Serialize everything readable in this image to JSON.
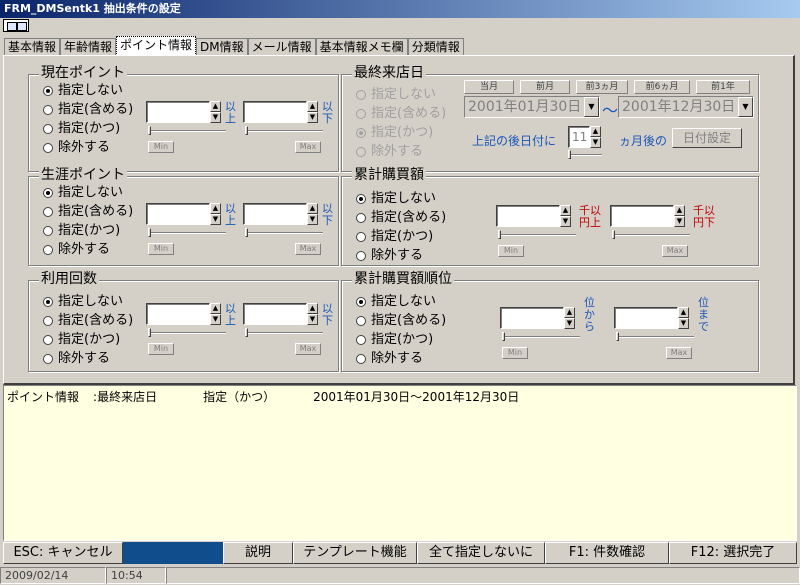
{
  "window": {
    "title": "FRM_DMSentk1 抽出条件の設定"
  },
  "tabs": [
    {
      "label": "基本情報"
    },
    {
      "label": "年齢情報"
    },
    {
      "label": "ポイント情報"
    },
    {
      "label": "DM情報"
    },
    {
      "label": "メール情報"
    },
    {
      "label": "基本情報メモ欄"
    },
    {
      "label": "分類情報"
    }
  ],
  "radio_options": [
    "指定しない",
    "指定(含める)",
    "指定(かつ)",
    "除外する"
  ],
  "groups": {
    "current_point": {
      "title": "現在ポイント",
      "selected": 0,
      "unit_low": "以上",
      "unit_high": "以下"
    },
    "lifetime_point": {
      "title": "生涯ポイント",
      "selected": 0,
      "unit_low": "以上",
      "unit_high": "以下"
    },
    "usage_count": {
      "title": "利用回数",
      "selected": 0,
      "unit_low": "以上",
      "unit_high": "以下"
    },
    "last_visit": {
      "title": "最終来店日",
      "selected": 2,
      "disabled": true,
      "quick_buttons": [
        "当月",
        "前月",
        "前3ヵ月",
        "前6ヵ月",
        "前1年"
      ],
      "date_from": "2001年01月30日",
      "date_to": "2001年12月30日",
      "after_label": "上記の後日付に",
      "months_value": "11",
      "months_label": "ヵ月後の",
      "set_date_button": "日付設定"
    },
    "total_purchase": {
      "title": "累計購買額",
      "selected": 0,
      "unit_low_top": "千以",
      "unit_low_bottom": "円上",
      "unit_high_top": "千以",
      "unit_high_bottom": "円下"
    },
    "purchase_rank": {
      "title": "累計購買額順位",
      "selected": 0,
      "unit_low": "位から",
      "unit_high": "位まで"
    }
  },
  "slider_labels": {
    "min": "Min",
    "max": "Max"
  },
  "log": {
    "lines": [
      {
        "category": "ポイント情報",
        "sep": ":",
        "item": "最終来店日",
        "mode": "指定（かつ）",
        "value": "2001年01月30日～2001年12月30日"
      }
    ]
  },
  "function_bar": {
    "esc": "ESC: キャンセル",
    "help": "説明",
    "template": "テンプレート機能",
    "clear_all": "全て指定しないに",
    "f1": "F1: 件数確認",
    "f12": "F12: 選択完了"
  },
  "statusbar": {
    "date": "2009/02/14",
    "time": "10:54"
  },
  "colors": {
    "face": "#d4d0c8",
    "accent_blue": "#1a56b8",
    "unit_red": "#c00000",
    "log_bg": "#ffffe1"
  }
}
